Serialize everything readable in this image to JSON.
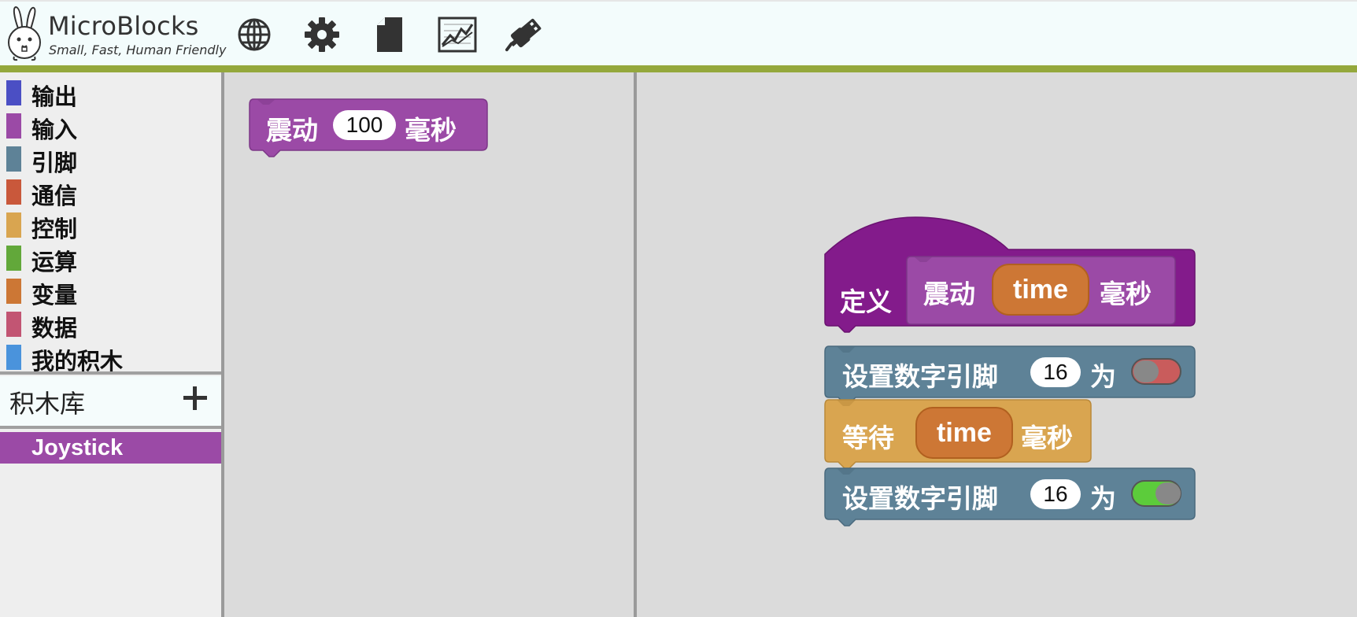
{
  "app": {
    "title": "MicroBlocks",
    "tagline": "Small, Fast, Human Friendly"
  },
  "toolbar": {
    "icons": [
      "globe-icon",
      "gear-icon",
      "file-icon",
      "graph-icon",
      "usb-plug-icon"
    ]
  },
  "palette": {
    "categories": [
      {
        "label": "输出",
        "color": "#4b4fc4"
      },
      {
        "label": "输入",
        "color": "#9b4aa6"
      },
      {
        "label": "引脚",
        "color": "#5e8297"
      },
      {
        "label": "通信",
        "color": "#c9583b"
      },
      {
        "label": "控制",
        "color": "#d9a550"
      },
      {
        "label": "运算",
        "color": "#62a83a"
      },
      {
        "label": "变量",
        "color": "#cc7735"
      },
      {
        "label": "数据",
        "color": "#c25573"
      },
      {
        "label": "我的积木",
        "color": "#4a93dc"
      }
    ],
    "library_title": "积木库",
    "libraries": [
      "Joystick"
    ]
  },
  "blocks_pane": {
    "vibrate_block": {
      "label": "震动",
      "value": "100",
      "unit": "毫秒"
    }
  },
  "script": {
    "hat": {
      "define_label": "定义",
      "label": "震动",
      "param": "time",
      "unit": "毫秒"
    },
    "set_pin_1": {
      "label": "设置数字引脚",
      "pin": "16",
      "to": "为",
      "state": "off"
    },
    "wait": {
      "label": "等待",
      "param": "time",
      "unit": "毫秒"
    },
    "set_pin_2": {
      "label": "设置数字引脚",
      "pin": "16",
      "to": "为",
      "state": "on"
    }
  },
  "colors": {
    "topbar_stripe": "#94a83c",
    "input_block": "#9b4aa6",
    "define_block": "#831b8b",
    "pins_block": "#5e8297",
    "control_block": "#d9a550",
    "variable": "#cd7735",
    "toggle_on": "#5ccc3b",
    "toggle_off": "#c95c5c"
  }
}
